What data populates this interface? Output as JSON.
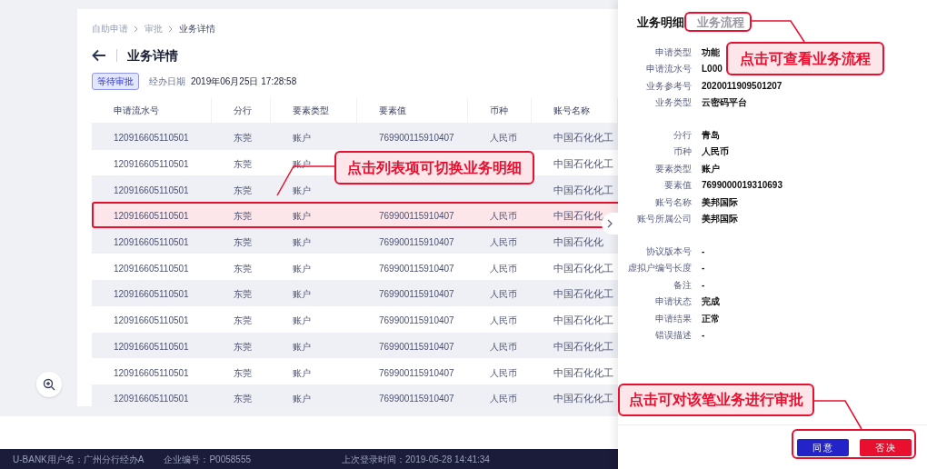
{
  "breadcrumb": [
    {
      "label": "自助申请",
      "current": false
    },
    {
      "label": "审批",
      "current": false
    },
    {
      "label": "业务详情",
      "current": true
    }
  ],
  "page_title": "业务详情",
  "status_badge": "等待审批",
  "date_label": "经办日期",
  "date_value": "2019年06月25日 17:28:58",
  "table": {
    "columns": [
      "申请流水号",
      "分行",
      "要素类型",
      "要素值",
      "币种",
      "账号名称"
    ],
    "rows": [
      {
        "cells": [
          "120916605110501",
          "东莞",
          "账户",
          "769900115910407",
          "人民币",
          "中国石化化工"
        ],
        "selected": false
      },
      {
        "cells": [
          "120916605110501",
          "东莞",
          "账户",
          "",
          "",
          "中国石化化工"
        ],
        "selected": false
      },
      {
        "cells": [
          "120916605110501",
          "东莞",
          "账户",
          "",
          "",
          "中国石化化工"
        ],
        "selected": false
      },
      {
        "cells": [
          "120916605110501",
          "东莞",
          "账户",
          "769900115910407",
          "人民币",
          "中国石化化"
        ],
        "selected": true
      },
      {
        "cells": [
          "120916605110501",
          "东莞",
          "账户",
          "769900115910407",
          "人民币",
          "中国石化化"
        ],
        "selected": false
      },
      {
        "cells": [
          "120916605110501",
          "东莞",
          "账户",
          "769900115910407",
          "人民币",
          "中国石化化工"
        ],
        "selected": false
      },
      {
        "cells": [
          "120916605110501",
          "东莞",
          "账户",
          "769900115910407",
          "人民币",
          "中国石化化工"
        ],
        "selected": false
      },
      {
        "cells": [
          "120916605110501",
          "东莞",
          "账户",
          "769900115910407",
          "人民币",
          "中国石化化工"
        ],
        "selected": false
      },
      {
        "cells": [
          "120916605110501",
          "东莞",
          "账户",
          "769900115910407",
          "人民币",
          "中国石化化工"
        ],
        "selected": false
      },
      {
        "cells": [
          "120916605110501",
          "东莞",
          "账户",
          "769900115910407",
          "人民币",
          "中国石化化工"
        ],
        "selected": false
      },
      {
        "cells": [
          "120916605110501",
          "东莞",
          "账户",
          "769900115910407",
          "人民币",
          "中国石化化工"
        ],
        "selected": false
      }
    ]
  },
  "detail_panel": {
    "tabs": [
      {
        "label": "业务明细",
        "selected": true
      },
      {
        "label": "业务流程",
        "selected": false
      }
    ],
    "groups": [
      [
        {
          "label": "申请类型",
          "value": "功能"
        },
        {
          "label": "申请流水号",
          "value": "L000"
        },
        {
          "label": "业务参考号",
          "value": "2020011909501207"
        },
        {
          "label": "业务类型",
          "value": "云密码平台"
        }
      ],
      [
        {
          "label": "分行",
          "value": "青岛"
        },
        {
          "label": "币种",
          "value": "人民币"
        },
        {
          "label": "要素类型",
          "value": "账户"
        },
        {
          "label": "要素值",
          "value": "7699000019310693"
        },
        {
          "label": "账号名称",
          "value": "美邦国际"
        },
        {
          "label": "账号所属公司",
          "value": "美邦国际"
        }
      ],
      [
        {
          "label": "协议版本号",
          "value": "-"
        },
        {
          "label": "虚拟户编号长度",
          "value": "-"
        },
        {
          "label": "备注",
          "value": "-"
        },
        {
          "label": "申请状态",
          "value": "完成"
        },
        {
          "label": "申请结果",
          "value": "正常"
        },
        {
          "label": "错误描述",
          "value": "-"
        }
      ]
    ],
    "actions": [
      {
        "label": "同意",
        "kind": "approve"
      },
      {
        "label": "否决",
        "kind": "reject"
      }
    ]
  },
  "callouts": [
    "点击列表项可切换业务明细",
    "点击可查看业务流程",
    "点击可对该笔业务进行审批"
  ],
  "footer": {
    "user": "U-BANK用户名：广州分行经办A",
    "company": "企业编号：P0058555",
    "last_login": "上次登录时间：2019-05-28  14:41:34"
  }
}
